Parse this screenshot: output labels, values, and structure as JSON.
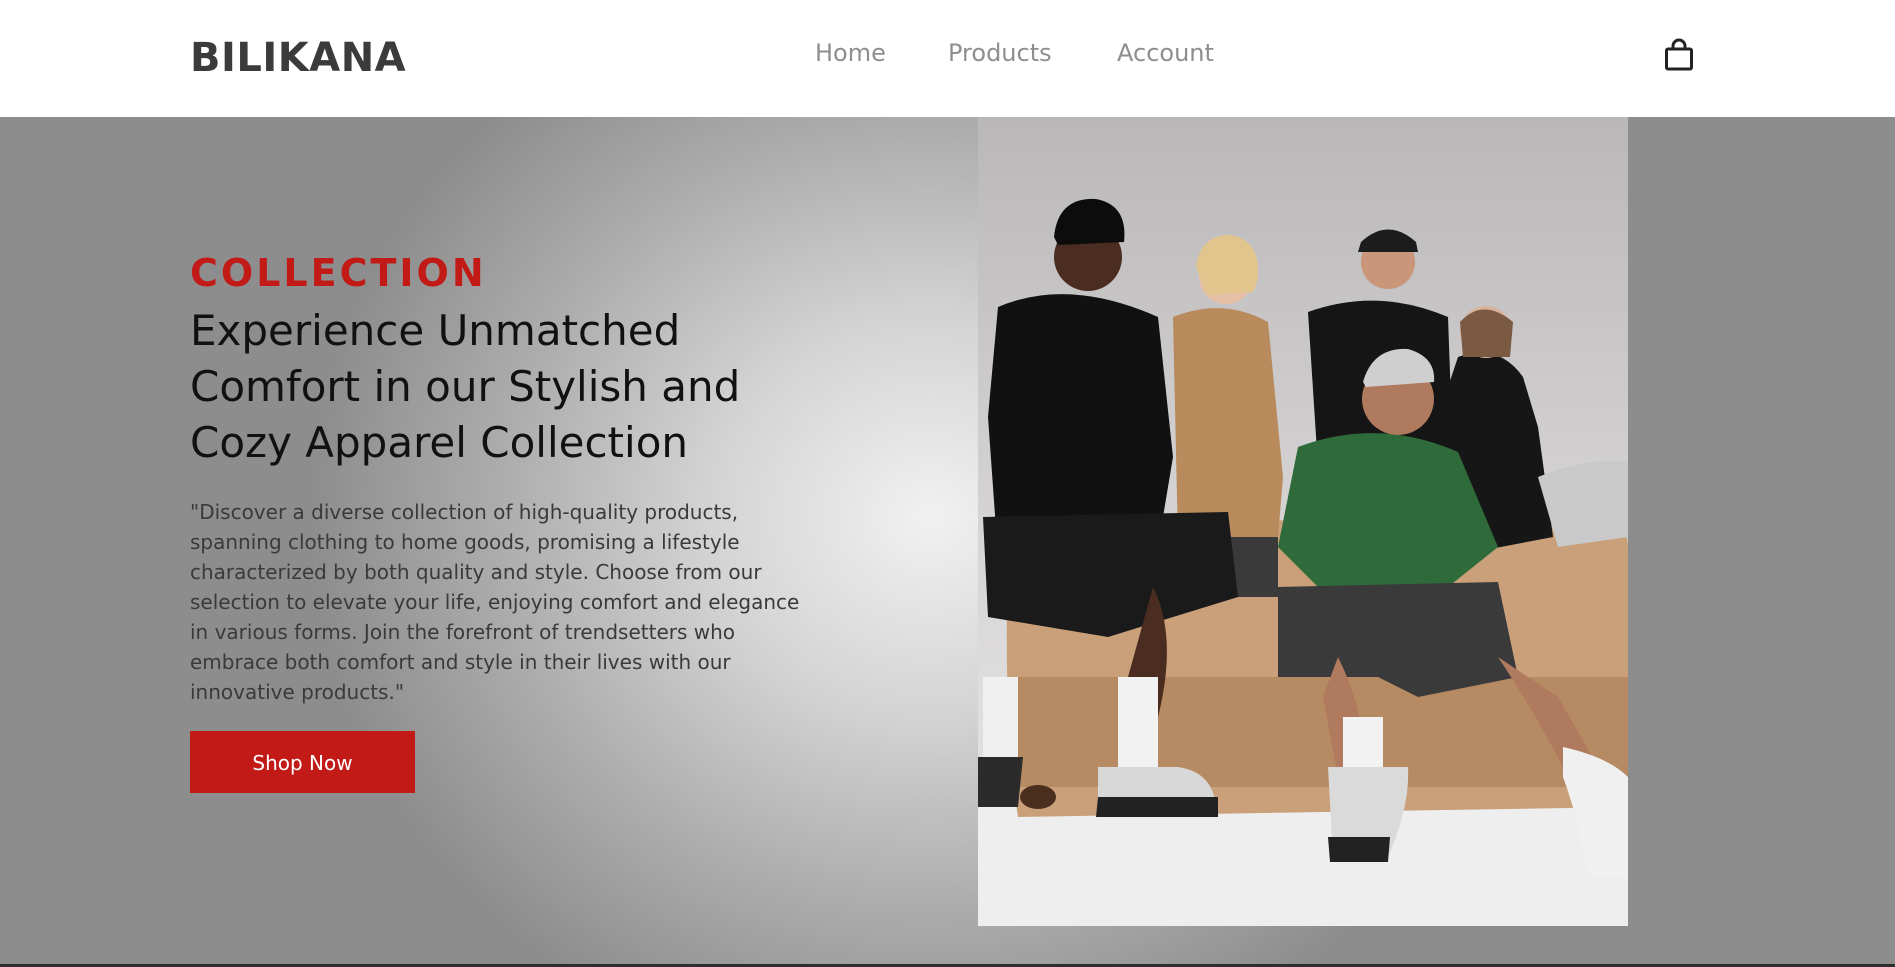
{
  "header": {
    "brand": "BILIKANA",
    "nav": [
      {
        "label": "Home"
      },
      {
        "label": "Products"
      },
      {
        "label": "Account"
      }
    ],
    "cart_icon": "shopping-bag-icon"
  },
  "hero": {
    "eyebrow": "COLLECTION",
    "headline": "Experience Unmatched Comfort in our Stylish and Cozy Apparel Collection",
    "description": "\"Discover a diverse collection of high-quality products, spanning clothing to home goods, promising a lifestyle characterized by both quality and style. Choose from our selection to elevate your life, enjoying comfort and elegance in various forms. Join the forefront of trendsetters who embrace both comfort and style in their lives with our innovative products.\"",
    "cta_label": "Shop Now",
    "image": "group of five young people in hoodies and t-shirts posing on a tan tufted leather sofa"
  },
  "colors": {
    "accent": "#c21b17",
    "brand_text": "#3b3b3b",
    "nav_text": "#8e8e8e"
  }
}
